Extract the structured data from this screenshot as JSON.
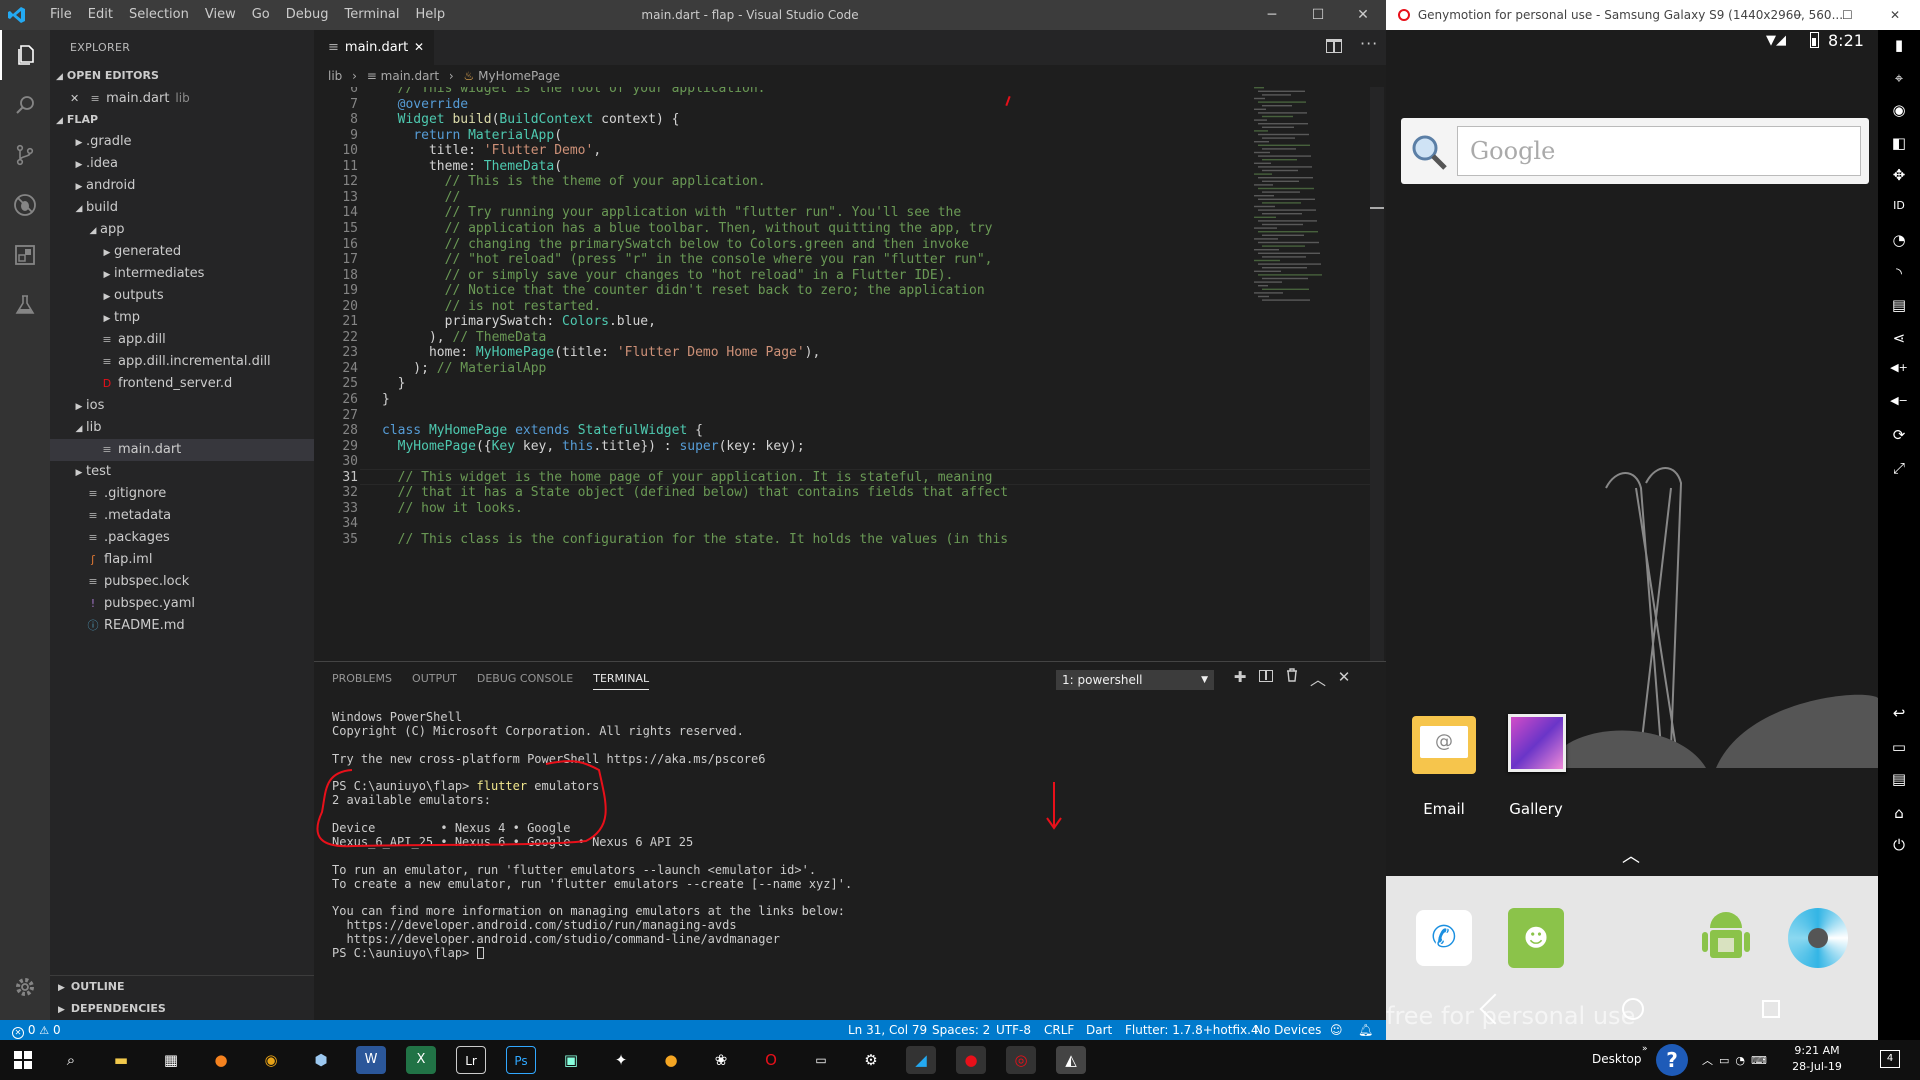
{
  "vscode": {
    "menu": [
      "File",
      "Edit",
      "Selection",
      "View",
      "Go",
      "Debug",
      "Terminal",
      "Help"
    ],
    "window_title": "main.dart - flap - Visual Studio Code",
    "explorer": {
      "header": "EXPLORER",
      "open_editors_label": "OPEN EDITORS",
      "open_editor": {
        "name": "main.dart",
        "desc": "lib"
      },
      "folder_label": "FLAP",
      "tree": [
        {
          "label": ".gradle",
          "indent": 1,
          "kind": "folder",
          "state": "closed"
        },
        {
          "label": ".idea",
          "indent": 1,
          "kind": "folder",
          "state": "closed"
        },
        {
          "label": "android",
          "indent": 1,
          "kind": "folder",
          "state": "closed"
        },
        {
          "label": "build",
          "indent": 1,
          "kind": "folder",
          "state": "open"
        },
        {
          "label": "app",
          "indent": 2,
          "kind": "folder",
          "state": "open"
        },
        {
          "label": "generated",
          "indent": 3,
          "kind": "folder",
          "state": "closed"
        },
        {
          "label": "intermediates",
          "indent": 3,
          "kind": "folder",
          "state": "closed"
        },
        {
          "label": "outputs",
          "indent": 3,
          "kind": "folder",
          "state": "closed"
        },
        {
          "label": "tmp",
          "indent": 3,
          "kind": "folder",
          "state": "closed"
        },
        {
          "label": "app.dill",
          "indent": 2,
          "kind": "file",
          "icon": "≡"
        },
        {
          "label": "app.dill.incremental.dill",
          "indent": 2,
          "kind": "file",
          "icon": "≡"
        },
        {
          "label": "frontend_server.d",
          "indent": 2,
          "kind": "file",
          "icon": "D"
        },
        {
          "label": "ios",
          "indent": 1,
          "kind": "folder",
          "state": "closed"
        },
        {
          "label": "lib",
          "indent": 1,
          "kind": "folder",
          "state": "open"
        },
        {
          "label": "main.dart",
          "indent": 2,
          "kind": "file",
          "icon": "≡",
          "selected": true
        },
        {
          "label": "test",
          "indent": 1,
          "kind": "folder",
          "state": "closed"
        },
        {
          "label": ".gitignore",
          "indent": 1,
          "kind": "file",
          "icon": "≡"
        },
        {
          "label": ".metadata",
          "indent": 1,
          "kind": "file",
          "icon": "≡"
        },
        {
          "label": ".packages",
          "indent": 1,
          "kind": "file",
          "icon": "≡"
        },
        {
          "label": "flap.iml",
          "indent": 1,
          "kind": "file",
          "icon": "ʃ"
        },
        {
          "label": "pubspec.lock",
          "indent": 1,
          "kind": "file",
          "icon": "≡"
        },
        {
          "label": "pubspec.yaml",
          "indent": 1,
          "kind": "file",
          "icon": "!"
        },
        {
          "label": "README.md",
          "indent": 1,
          "kind": "file",
          "icon": "ⓘ"
        }
      ],
      "outline_label": "OUTLINE",
      "dependencies_label": "DEPENDENCIES"
    },
    "tab": {
      "label": "main.dart"
    },
    "breadcrumb": [
      "lib",
      "main.dart",
      "MyHomePage"
    ],
    "code": [
      {
        "n": "6",
        "html": "  <span class='c'>// This widget is the root of your application.</span>"
      },
      {
        "n": "7",
        "html": "  <span class='k'>@override</span>"
      },
      {
        "n": "8",
        "html": "  <span class='t'>Widget</span> <span class='f'>build</span>(<span class='t'>BuildContext</span> context) {"
      },
      {
        "n": "9",
        "html": "    <span class='k'>return</span> <span class='t'>MaterialApp</span>("
      },
      {
        "n": "10",
        "html": "      title: <span class='s'>'Flutter Demo'</span>,"
      },
      {
        "n": "11",
        "html": "      theme: <span class='t'>ThemeData</span>("
      },
      {
        "n": "12",
        "html": "        <span class='c'>// This is the theme of your application.</span>"
      },
      {
        "n": "13",
        "html": "        <span class='c'>//</span>"
      },
      {
        "n": "14",
        "html": "        <span class='c'>// Try running your application with \"flutter run\". You'll see the</span>"
      },
      {
        "n": "15",
        "html": "        <span class='c'>// application has a blue toolbar. Then, without quitting the app, try</span>"
      },
      {
        "n": "16",
        "html": "        <span class='c'>// changing the primarySwatch below to Colors.green and then invoke</span>"
      },
      {
        "n": "17",
        "html": "        <span class='c'>// \"hot reload\" (press \"r\" in the console where you ran \"flutter run\",</span>"
      },
      {
        "n": "18",
        "html": "        <span class='c'>// or simply save your changes to \"hot reload\" in a Flutter IDE).</span>"
      },
      {
        "n": "19",
        "html": "        <span class='c'>// Notice that the counter didn't reset back to zero; the application</span>"
      },
      {
        "n": "20",
        "html": "        <span class='c'>// is not restarted.</span>"
      },
      {
        "n": "21",
        "html": "        primarySwatch: <span class='t'>Colors</span>.blue,"
      },
      {
        "n": "22",
        "html": "      ), <span class='c'>// ThemeData</span>"
      },
      {
        "n": "23",
        "html": "      home: <span class='t'>MyHomePage</span>(title: <span class='s'>'Flutter Demo Home Page'</span>),"
      },
      {
        "n": "24",
        "html": "    ); <span class='c'>// MaterialApp</span>"
      },
      {
        "n": "25",
        "html": "  }"
      },
      {
        "n": "26",
        "html": "}"
      },
      {
        "n": "27",
        "html": ""
      },
      {
        "n": "28",
        "html": "<span class='k'>class</span> <span class='t'>MyHomePage</span> <span class='k'>extends</span> <span class='t'>StatefulWidget</span> {"
      },
      {
        "n": "29",
        "html": "  <span class='t'>MyHomePage</span>({<span class='t'>Key</span> key, <span class='k'>this</span>.title}) : <span class='k'>super</span>(key: key);"
      },
      {
        "n": "30",
        "html": ""
      },
      {
        "n": "31",
        "html": "  <span class='c'>// This widget is the home page of your application. It is stateful, meaning</span>"
      },
      {
        "n": "32",
        "html": "  <span class='c'>// that it has a State object (defined below) that contains fields that affect</span>"
      },
      {
        "n": "33",
        "html": "  <span class='c'>// how it looks.</span>"
      },
      {
        "n": "34",
        "html": ""
      },
      {
        "n": "35",
        "html": "  <span class='c'>// This class is the configuration for the state. It holds the values (in this</span>"
      }
    ],
    "panel": {
      "tabs": [
        "PROBLEMS",
        "OUTPUT",
        "DEBUG CONSOLE",
        "TERMINAL"
      ],
      "active_tab": "TERMINAL",
      "terminal_select": "1: powershell",
      "terminal_lines": [
        "Windows PowerShell",
        "Copyright (C) Microsoft Corporation. All rights reserved.",
        "",
        "Try the new cross-platform PowerShell https://aka.ms/pscore6",
        "",
        "PS C:\\auniuyo\\flap> flutter emulators",
        "2 available emulators:",
        "",
        "Device         • Nexus 4 • Google",
        "Nexus_6_API_25 • Nexus 6 • Google • Nexus 6 API 25",
        "",
        "To run an emulator, run 'flutter emulators --launch <emulator id>'.",
        "To create a new emulator, run 'flutter emulators --create [--name xyz]'.",
        "",
        "You can find more information on managing emulators at the links below:",
        "  https://developer.android.com/studio/run/managing-avds",
        "  https://developer.android.com/studio/command-line/avdmanager",
        "PS C:\\auniuyo\\flap> "
      ]
    },
    "status": {
      "errors": "0",
      "warnings": "0",
      "position": "Ln 31, Col 79",
      "spaces": "Spaces: 2",
      "encoding": "UTF-8",
      "eol": "CRLF",
      "language": "Dart",
      "flutter": "Flutter: 1.7.8+hotfix.4",
      "devices": "No Devices"
    }
  },
  "genymotion": {
    "title": "Genymotion for personal use - Samsung Galaxy S9 (1440x2960, 560...",
    "clock": "8:21",
    "search_placeholder": "Google",
    "apps": [
      {
        "label": "Email"
      },
      {
        "label": "Gallery"
      }
    ],
    "watermark": "free for personal use"
  },
  "taskbar": {
    "desktop_label": "Desktop",
    "time": "9:21 AM",
    "date": "28-Jul-19",
    "notif_count": "4"
  },
  "colors": {
    "statusbar": "#007acc",
    "annotation": "#e8101a",
    "accent": "#23a9f2"
  }
}
